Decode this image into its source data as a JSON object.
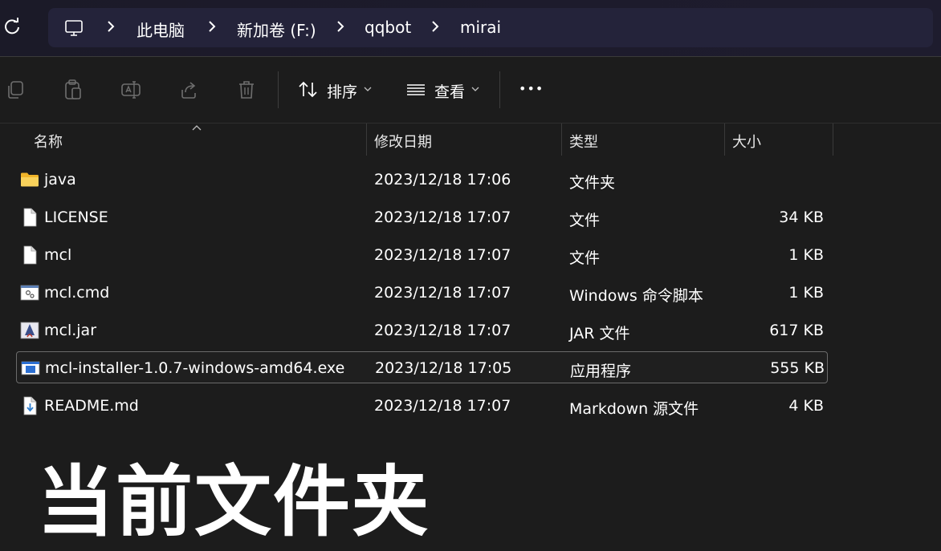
{
  "breadcrumb": {
    "items": [
      "此电脑",
      "新加卷 (F:)",
      "qqbot",
      "mirai"
    ]
  },
  "toolbar": {
    "sort_label": "排序",
    "view_label": "查看",
    "more_label": "•••"
  },
  "columns": {
    "name": "名称",
    "modified": "修改日期",
    "type": "类型",
    "size": "大小"
  },
  "files": [
    {
      "name": "java",
      "modified": "2023/12/18 17:06",
      "type": "文件夹",
      "size": "",
      "icon": "folder-icon"
    },
    {
      "name": "LICENSE",
      "modified": "2023/12/18 17:07",
      "type": "文件",
      "size": "34 KB",
      "icon": "file-icon"
    },
    {
      "name": "mcl",
      "modified": "2023/12/18 17:07",
      "type": "文件",
      "size": "1 KB",
      "icon": "file-icon"
    },
    {
      "name": "mcl.cmd",
      "modified": "2023/12/18 17:07",
      "type": "Windows 命令脚本",
      "size": "1 KB",
      "icon": "cmd-script-icon"
    },
    {
      "name": "mcl.jar",
      "modified": "2023/12/18 17:07",
      "type": "JAR 文件",
      "size": "617 KB",
      "icon": "java-jar-icon"
    },
    {
      "name": "mcl-installer-1.0.7-windows-amd64.exe",
      "modified": "2023/12/18 17:05",
      "type": "应用程序",
      "size": "555 KB",
      "icon": "exe-icon"
    },
    {
      "name": "README.md",
      "modified": "2023/12/18 17:07",
      "type": "Markdown 源文件",
      "size": "4 KB",
      "icon": "markdown-icon"
    }
  ],
  "overlay_caption": "当前文件夹",
  "colors": {
    "background": "#1c1c1c",
    "address_bar": "#24233a",
    "folder": "#f4c542"
  }
}
